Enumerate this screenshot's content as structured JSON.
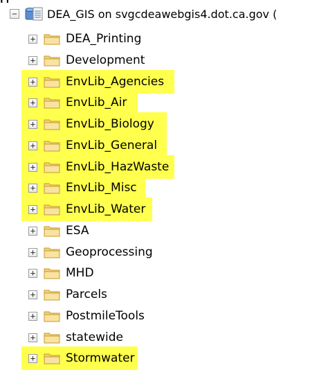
{
  "top_clip_text": "g",
  "tree": {
    "root": {
      "label": "DEA_GIS on svgcdeawebgis4.dot.ca.gov (",
      "toggle": "−"
    },
    "items": [
      {
        "label": "DEA_Printing",
        "highlighted": false,
        "toggle": "+"
      },
      {
        "label": "Development",
        "highlighted": false,
        "toggle": "+"
      },
      {
        "label": "EnvLib_Agencies",
        "highlighted": true,
        "toggle": "+"
      },
      {
        "label": "EnvLib_Air",
        "highlighted": true,
        "toggle": "+"
      },
      {
        "label": "EnvLib_Biology",
        "highlighted": true,
        "toggle": "+"
      },
      {
        "label": "EnvLib_General",
        "highlighted": true,
        "toggle": "+"
      },
      {
        "label": "EnvLib_HazWaste",
        "highlighted": true,
        "toggle": "+"
      },
      {
        "label": "EnvLib_Misc",
        "highlighted": true,
        "toggle": "+"
      },
      {
        "label": "EnvLib_Water",
        "highlighted": true,
        "toggle": "+"
      },
      {
        "label": "ESA",
        "highlighted": false,
        "toggle": "+"
      },
      {
        "label": "Geoprocessing",
        "highlighted": false,
        "toggle": "+"
      },
      {
        "label": "MHD",
        "highlighted": false,
        "toggle": "+"
      },
      {
        "label": "Parcels",
        "highlighted": false,
        "toggle": "+"
      },
      {
        "label": "PostmileTools",
        "highlighted": false,
        "toggle": "+"
      },
      {
        "label": "statewide",
        "highlighted": false,
        "toggle": "+"
      },
      {
        "label": "Stormwater",
        "highlighted": true,
        "toggle": "+"
      }
    ],
    "colors": {
      "highlight": "#ffff4d",
      "folder_fill": "#f2d27a",
      "folder_edge": "#c79a2c"
    },
    "icons": {
      "root": "database-connection-icon",
      "item": "folder-icon",
      "toggle": "expand-toggle-icon"
    }
  }
}
